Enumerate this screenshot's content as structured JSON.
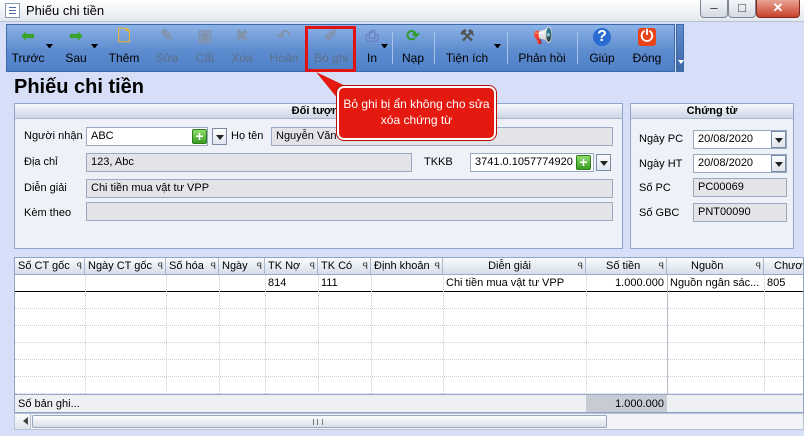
{
  "window": {
    "title": "Phiếu chi tiền",
    "min": "–",
    "max": "□",
    "close": "✕"
  },
  "toolbar": {
    "prev": "Trước",
    "next": "Sau",
    "add": "Thêm",
    "edit": "Sửa",
    "save": "Cất",
    "delete": "Xóa",
    "undo": "Hoãn",
    "unpost": "Bỏ ghi",
    "print": "In",
    "reload": "Nạp",
    "utilities": "Tiện ích",
    "feedback": "Phản hồi",
    "help": "Giúp",
    "close": "Đóng"
  },
  "callout": {
    "text": "Bỏ ghi bị ẩn không cho sửa xóa chứng từ"
  },
  "page_title": "Phiếu chi tiền",
  "doituong": {
    "header": "Đối tượng",
    "receiver_label": "Người nhận",
    "receiver_value": "ABC",
    "name_label": "Họ tên",
    "name_value": "Nguyễn Văn A",
    "address_label": "Địa chỉ",
    "address_value": "123, Abc",
    "tkkb_label": "TKKB",
    "tkkb_value": "3741.0.1057774920",
    "desc_label": "Diễn giải",
    "desc_value": "Chi tiền mua vật tư VPP",
    "attach_label": "Kèm theo",
    "attach_value": ""
  },
  "chungtu": {
    "header": "Chứng từ",
    "ngaypc_label": "Ngày PC",
    "ngaypc_value": "20/08/2020",
    "ngayht_label": "Ngày HT",
    "ngayht_value": "20/08/2020",
    "sopc_label": "Số PC",
    "sopc_value": "PC00069",
    "sogbc_label": "Số GBC",
    "sogbc_value": "PNT00090"
  },
  "grid": {
    "columns": [
      "Số CT gốc",
      "Ngày CT gốc",
      "Số hóa",
      "Ngày",
      "TK Nợ",
      "TK Có",
      "Định khoản",
      "Diễn giải",
      "Số tiền",
      "Nguồn",
      "Chươ"
    ],
    "row1": {
      "tkno": "814",
      "tkco": "111",
      "diengiai": "Chi tiền mua vật tư VPP",
      "sotien": "1.000.000",
      "nguon": "Nguồn ngân sác...",
      "chuong": "805"
    },
    "footer_label": "Số bản ghi...",
    "footer_total": "1.000.000"
  }
}
